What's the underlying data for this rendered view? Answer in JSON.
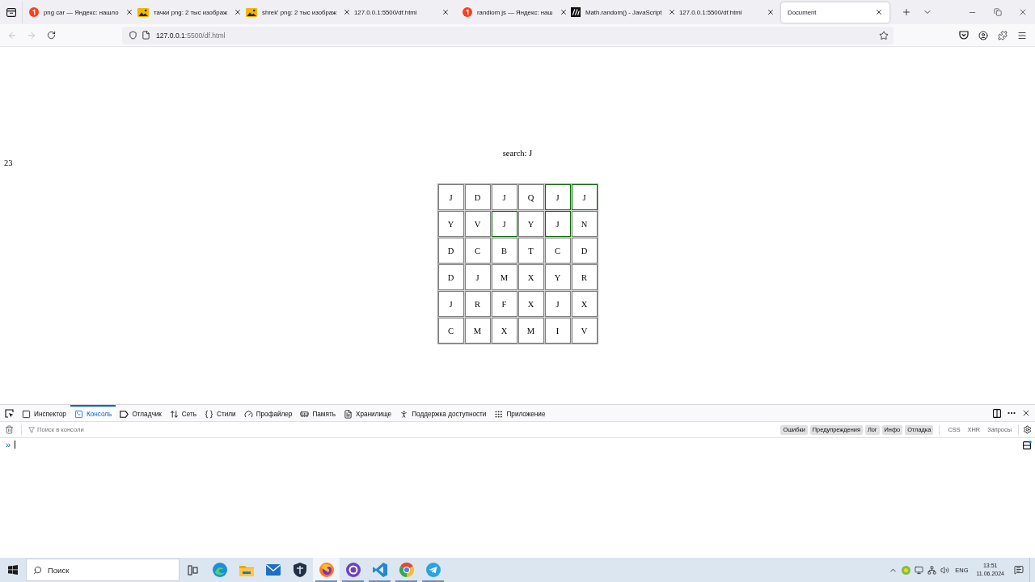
{
  "browser": {
    "tabs": [
      {
        "kind": "round_logo",
        "title": "png car — Яндекс: нашло",
        "selected": false
      },
      {
        "kind": "image",
        "title": "тачки png: 2 тыс изображ",
        "selected": false
      },
      {
        "kind": "image",
        "title": "shrek' png: 2 тыс изображ",
        "selected": false
      },
      {
        "kind": "none",
        "title": "127.0.0.1:5500/df.html",
        "selected": false
      },
      {
        "kind": "round_logo",
        "title": "randiom js — Яндекс: наш",
        "selected": false
      },
      {
        "kind": "square_logo",
        "title": "Math.random() - JavaScript",
        "selected": false
      },
      {
        "kind": "none",
        "title": "127.0.0.1:5500/df.html",
        "selected": false
      },
      {
        "kind": "none",
        "title": "Document",
        "selected": true
      }
    ]
  },
  "toolbar": {
    "can_go_back": false,
    "can_go_forward": false,
    "url_host": "127.0.0.1",
    "url_path": ":5500/df.html"
  },
  "page": {
    "search_label": "search: J",
    "counter": "23",
    "grid": [
      [
        {
          "letter": "J",
          "highlighted": false
        },
        {
          "letter": "D",
          "highlighted": false
        },
        {
          "letter": "J",
          "highlighted": false
        },
        {
          "letter": "Q",
          "highlighted": false
        },
        {
          "letter": "J",
          "highlighted": true
        },
        {
          "letter": "J",
          "highlighted": true
        }
      ],
      [
        {
          "letter": "Y",
          "highlighted": false
        },
        {
          "letter": "V",
          "highlighted": false
        },
        {
          "letter": "J",
          "highlighted": true
        },
        {
          "letter": "Y",
          "highlighted": false
        },
        {
          "letter": "J",
          "highlighted": true
        },
        {
          "letter": "N",
          "highlighted": false
        }
      ],
      [
        {
          "letter": "D",
          "highlighted": false
        },
        {
          "letter": "C",
          "highlighted": false
        },
        {
          "letter": "B",
          "highlighted": false
        },
        {
          "letter": "T",
          "highlighted": false
        },
        {
          "letter": "C",
          "highlighted": false
        },
        {
          "letter": "D",
          "highlighted": false
        }
      ],
      [
        {
          "letter": "D",
          "highlighted": false
        },
        {
          "letter": "J",
          "highlighted": false
        },
        {
          "letter": "M",
          "highlighted": false
        },
        {
          "letter": "X",
          "highlighted": false
        },
        {
          "letter": "Y",
          "highlighted": false
        },
        {
          "letter": "R",
          "highlighted": false
        }
      ],
      [
        {
          "letter": "J",
          "highlighted": false
        },
        {
          "letter": "R",
          "highlighted": false
        },
        {
          "letter": "F",
          "highlighted": false
        },
        {
          "letter": "X",
          "highlighted": false
        },
        {
          "letter": "J",
          "highlighted": false
        },
        {
          "letter": "X",
          "highlighted": false
        }
      ],
      [
        {
          "letter": "C",
          "highlighted": false
        },
        {
          "letter": "M",
          "highlighted": false
        },
        {
          "letter": "X",
          "highlighted": false
        },
        {
          "letter": "M",
          "highlighted": false
        },
        {
          "letter": "I",
          "highlighted": false
        },
        {
          "letter": "V",
          "highlighted": false
        }
      ]
    ]
  },
  "devtools": {
    "tabs": [
      {
        "kind": "inspector",
        "label": "Инспектор",
        "selected": false
      },
      {
        "kind": "console",
        "label": "Консоль",
        "selected": true
      },
      {
        "kind": "debugger",
        "label": "Отладчик",
        "selected": false
      },
      {
        "kind": "network",
        "label": "Сеть",
        "selected": false
      },
      {
        "kind": "style",
        "label": "Стили",
        "selected": false
      },
      {
        "kind": "performance",
        "label": "Профайлер",
        "selected": false
      },
      {
        "kind": "memory",
        "label": "Память",
        "selected": false
      },
      {
        "kind": "storage",
        "label": "Хранилище",
        "selected": false
      },
      {
        "kind": "accessibility",
        "label": "Поддержка доступности",
        "selected": false
      },
      {
        "kind": "application",
        "label": "Приложение",
        "selected": false
      }
    ],
    "filter_placeholder": "Поиск в консоли",
    "log_levels": [
      {
        "label": "Ошибки",
        "on": true
      },
      {
        "label": "Предупреждения",
        "on": true
      },
      {
        "label": "Лог",
        "on": true
      },
      {
        "label": "Инфо",
        "on": true
      },
      {
        "label": "Отладка",
        "on": true
      }
    ],
    "request_types": [
      {
        "label": "CSS",
        "on": false
      },
      {
        "label": "XHR",
        "on": false
      },
      {
        "label": "Запросы",
        "on": false
      }
    ],
    "prompt": "»"
  },
  "taskbar": {
    "search_placeholder": "Поиск",
    "apps": [
      {
        "kind": "task_view",
        "running": false,
        "active": false
      },
      {
        "kind": "wave_browser",
        "running": false,
        "active": false
      },
      {
        "kind": "folder",
        "running": false,
        "active": false
      },
      {
        "kind": "mail",
        "running": false,
        "active": false
      },
      {
        "kind": "shield",
        "running": false,
        "active": false
      },
      {
        "kind": "flame_browser",
        "running": true,
        "active": true
      },
      {
        "kind": "ring_logo",
        "running": true,
        "active": false
      },
      {
        "kind": "ribbon_editor",
        "running": true,
        "active": false
      },
      {
        "kind": "wheel_browser",
        "running": true,
        "active": false
      },
      {
        "kind": "paper_plane",
        "running": true,
        "active": false
      }
    ],
    "language": "ENG",
    "time": "13:51",
    "date": "11.06.2024"
  }
}
